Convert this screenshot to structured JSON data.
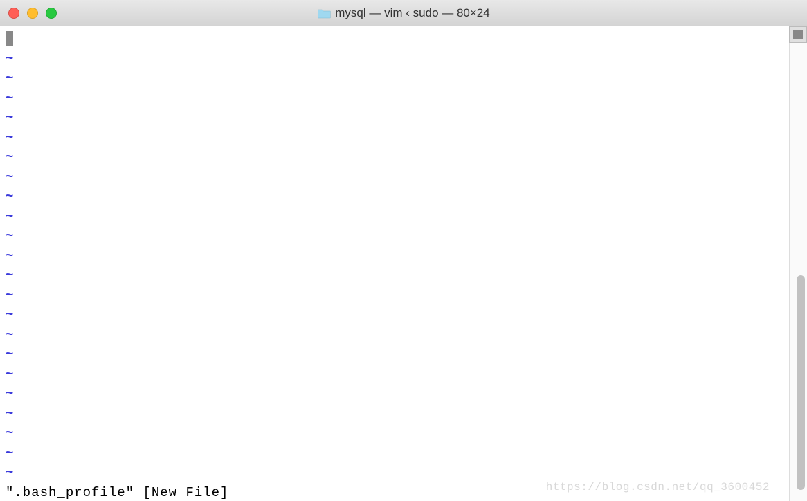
{
  "window": {
    "title": "mysql — vim ‹ sudo — 80×24"
  },
  "editor": {
    "tilde_char": "~",
    "tilde_count": 22,
    "status_line": "\".bash_profile\" [New File]"
  },
  "watermark": "https://blog.csdn.net/qq_3600452"
}
